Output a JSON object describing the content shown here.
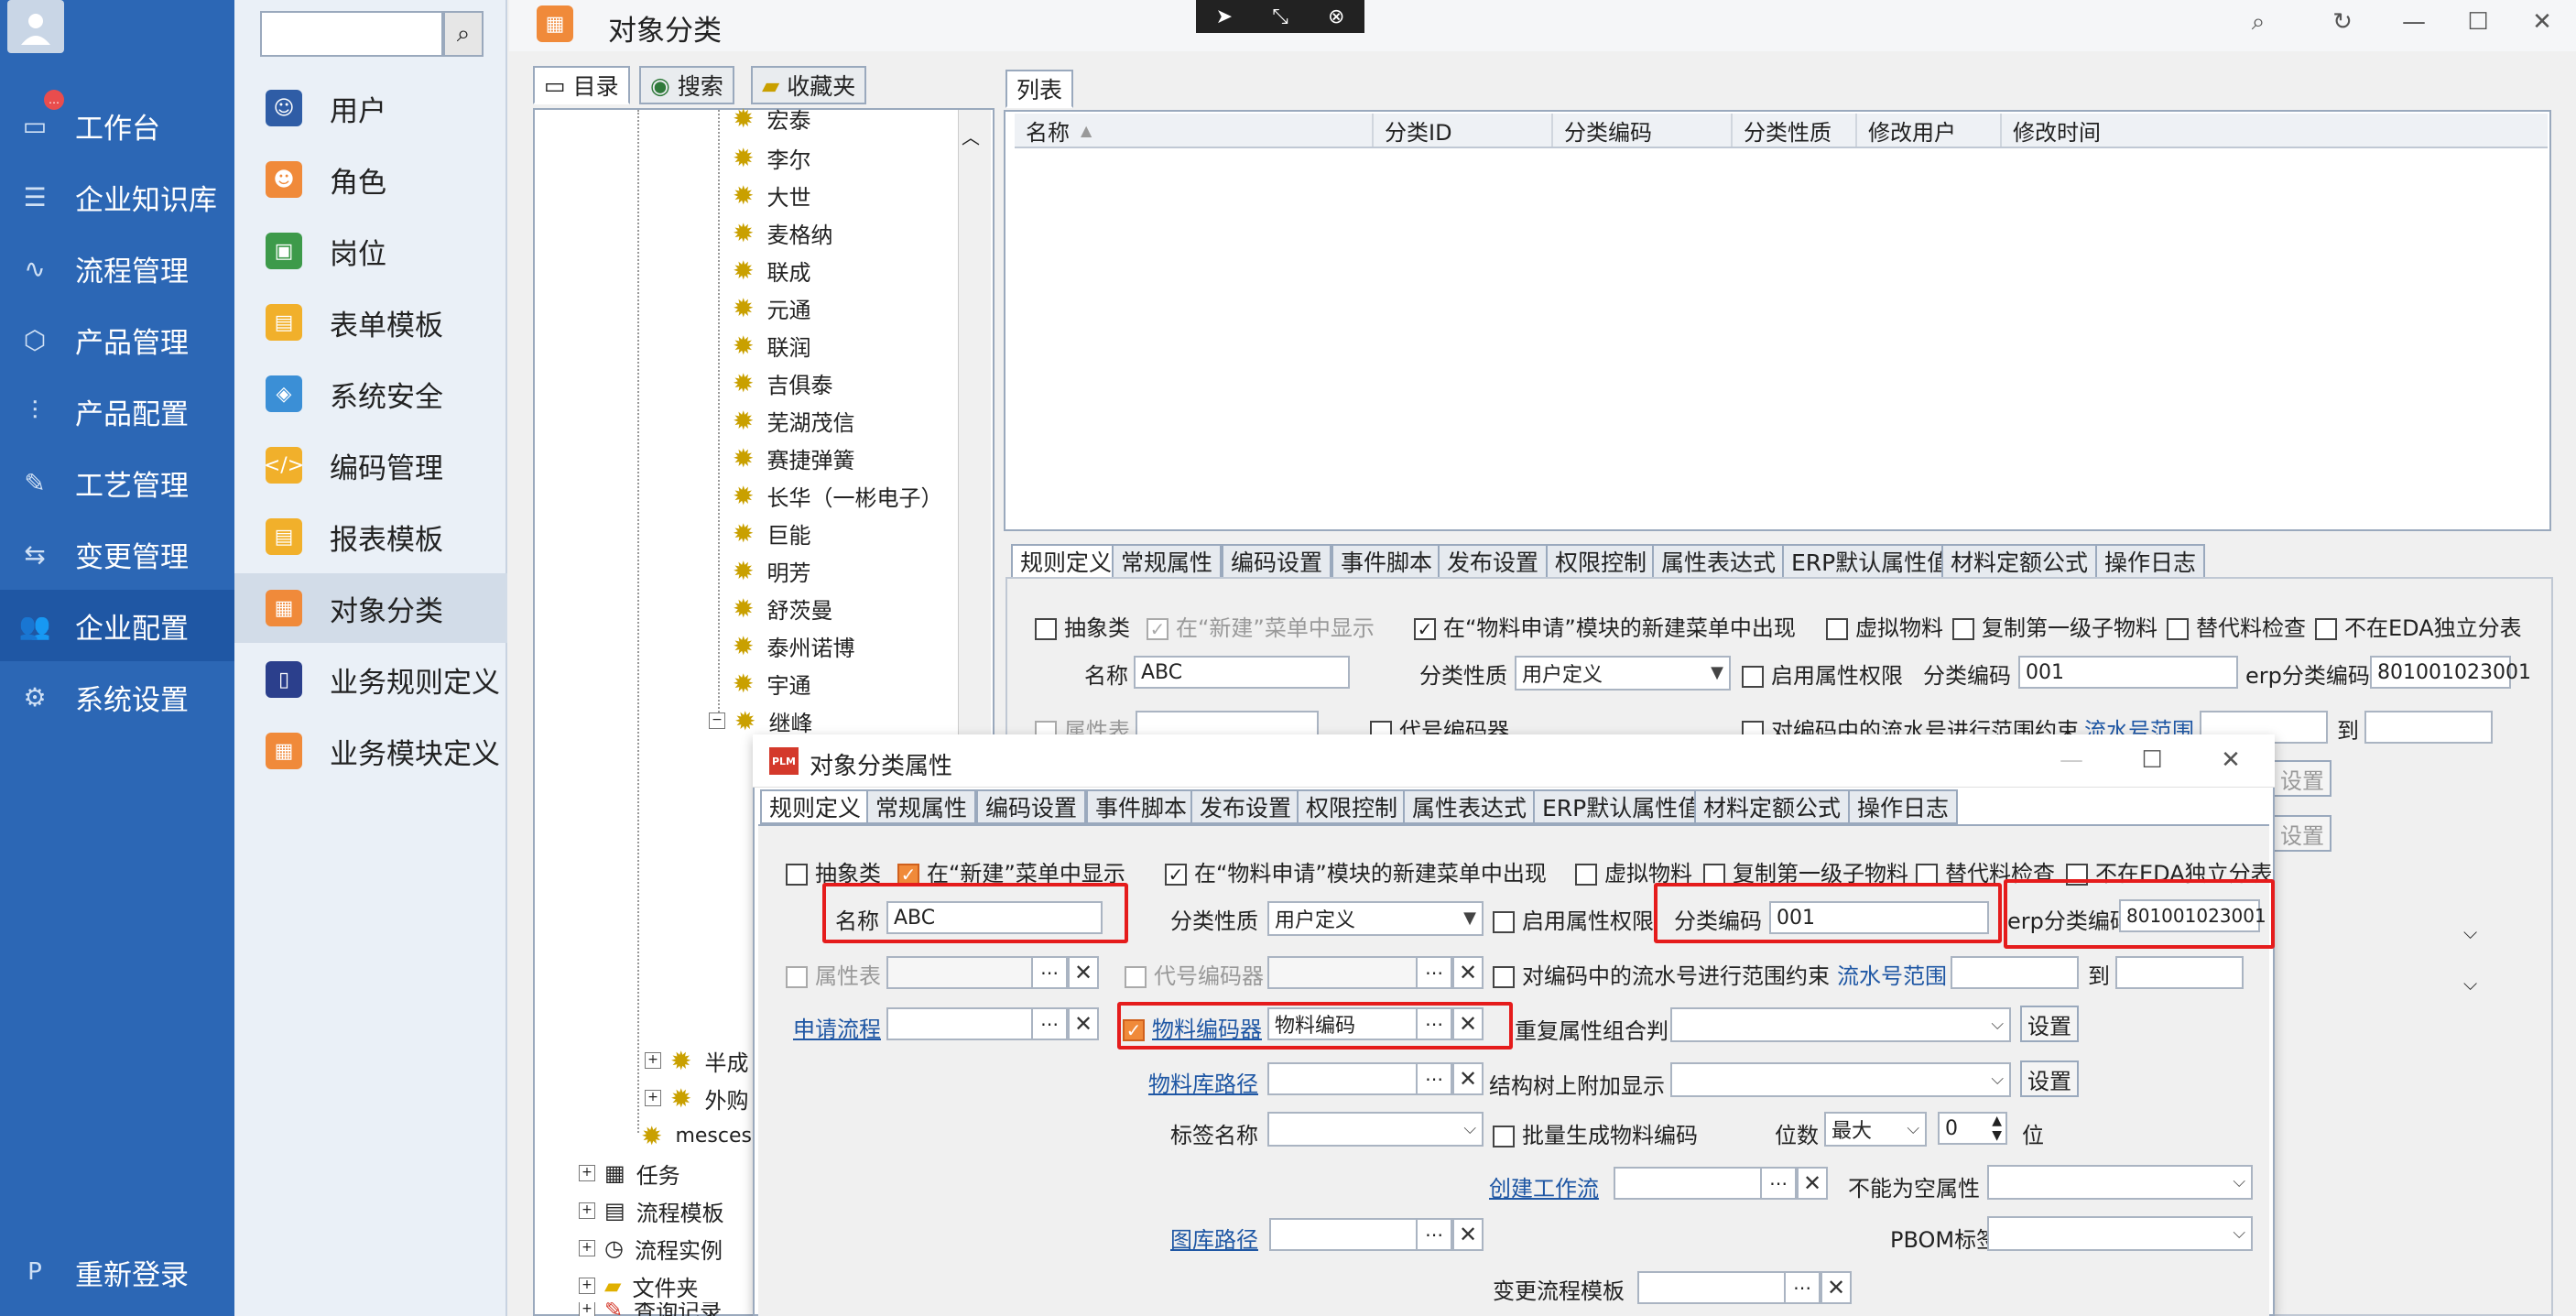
{
  "left_nav": {
    "items": [
      {
        "label": "工作台",
        "icon": "monitor-icon"
      },
      {
        "label": "企业知识库",
        "icon": "book-icon"
      },
      {
        "label": "流程管理",
        "icon": "flow-icon"
      },
      {
        "label": "产品管理",
        "icon": "cube-icon"
      },
      {
        "label": "产品配置",
        "icon": "sliders-icon"
      },
      {
        "label": "工艺管理",
        "icon": "wrench-icon"
      },
      {
        "label": "变更管理",
        "icon": "change-icon"
      },
      {
        "label": "企业配置",
        "icon": "users-icon"
      },
      {
        "label": "系统设置",
        "icon": "gear-icon"
      }
    ],
    "relogin": "重新登录"
  },
  "sub_menu": {
    "items": [
      {
        "label": "用户"
      },
      {
        "label": "角色"
      },
      {
        "label": "岗位"
      },
      {
        "label": "表单模板"
      },
      {
        "label": "系统安全"
      },
      {
        "label": "编码管理"
      },
      {
        "label": "报表模板"
      },
      {
        "label": "对象分类"
      },
      {
        "label": "业务规则定义"
      },
      {
        "label": "业务模块定义"
      }
    ]
  },
  "title": "对象分类",
  "tree_tabs": {
    "catalog": "目录",
    "search": "搜索",
    "favorites": "收藏夹"
  },
  "tree": {
    "nodes": [
      "宏泰",
      "李尔",
      "大世",
      "麦格纳",
      "联成",
      "元通",
      "联润",
      "吉俱泰",
      "芜湖茂信",
      "赛捷弹簧",
      "长华（一彬电子）",
      "巨能",
      "明芳",
      "舒茨曼",
      "泰州诺博",
      "宇通",
      "继峰"
    ],
    "bottom": [
      "半成",
      "外购",
      "mesceshi",
      "任务",
      "流程模板",
      "流程实例",
      "文件夹",
      "查询记录"
    ]
  },
  "list": {
    "tab": "列表",
    "columns": [
      "名称",
      "分类ID",
      "分类编码",
      "分类性质",
      "修改用户",
      "修改时间"
    ]
  },
  "rule_tabs": [
    "规则定义",
    "常规属性",
    "编码设置",
    "事件脚本",
    "发布设置",
    "权限控制",
    "属性表达式",
    "ERP默认属性值",
    "材料定额公式",
    "操作日志"
  ],
  "bg_form": {
    "abstract": "抽象类",
    "show_in_new": "在“新建”菜单中显示",
    "show_in_material": "在“物料申请”模块的新建菜单中出现",
    "virtual": "虚拟物料",
    "copy_first": "复制第一级子物料",
    "substitute": "替代料检查",
    "not_eda": "不在EDA独立分表",
    "name_label": "名称",
    "name_value": "ABC",
    "nature_label": "分类性质",
    "nature_value": "用户定义",
    "enable_perm": "启用属性权限",
    "code_label": "分类编码",
    "code_value": "001",
    "erp_label": "erp分类编码",
    "erp_value": "801001023001",
    "attr_table": "属性表",
    "code_gen": "代号编码器",
    "serial_constraint": "对编码中的流水号进行范围约束",
    "serial_range": "流水号范围",
    "to": "到",
    "set": "设置"
  },
  "dialog": {
    "title": "对象分类属性",
    "tabs": [
      "规则定义",
      "常规属性",
      "编码设置",
      "事件脚本",
      "发布设置",
      "权限控制",
      "属性表达式",
      "ERP默认属性值",
      "材料定额公式",
      "操作日志"
    ],
    "abstract": "抽象类",
    "show_in_new": "在“新建”菜单中显示",
    "show_in_material": "在“物料申请”模块的新建菜单中出现",
    "virtual": "虚拟物料",
    "copy_first": "复制第一级子物料",
    "substitute": "替代料检查",
    "not_eda": "不在EDA独立分表",
    "name_label": "名称",
    "name_value": "ABC",
    "nature_label": "分类性质",
    "nature_value": "用户定义",
    "enable_perm": "启用属性权限",
    "code_label": "分类编码",
    "code_value": "001",
    "erp_label": "erp分类编码",
    "erp_value": "801001023001",
    "attr_table": "属性表",
    "code_gen": "代号编码器",
    "serial_constraint": "对编码中的流水号进行范围约束",
    "serial_range": "流水号范围",
    "to": "到",
    "apply_flow": "申请流程",
    "material_encoder": "物料编码器",
    "material_encoder_value": "物料编码",
    "repeat_attr": "重复属性组合判断",
    "set": "设置",
    "material_lib": "物料库路径",
    "struct_tree": "结构树上附加显示",
    "tag_name": "标签名称",
    "batch_gen": "批量生成物料编码",
    "digits": "位数",
    "digits_value": "最大",
    "digits_num": "0",
    "digits_unit": "位",
    "create_workflow": "创建工作流",
    "not_null": "不能为空属性",
    "drawing_lib": "图库路径",
    "pbom_tag": "PBOM标签",
    "change_flow": "变更流程模板"
  }
}
